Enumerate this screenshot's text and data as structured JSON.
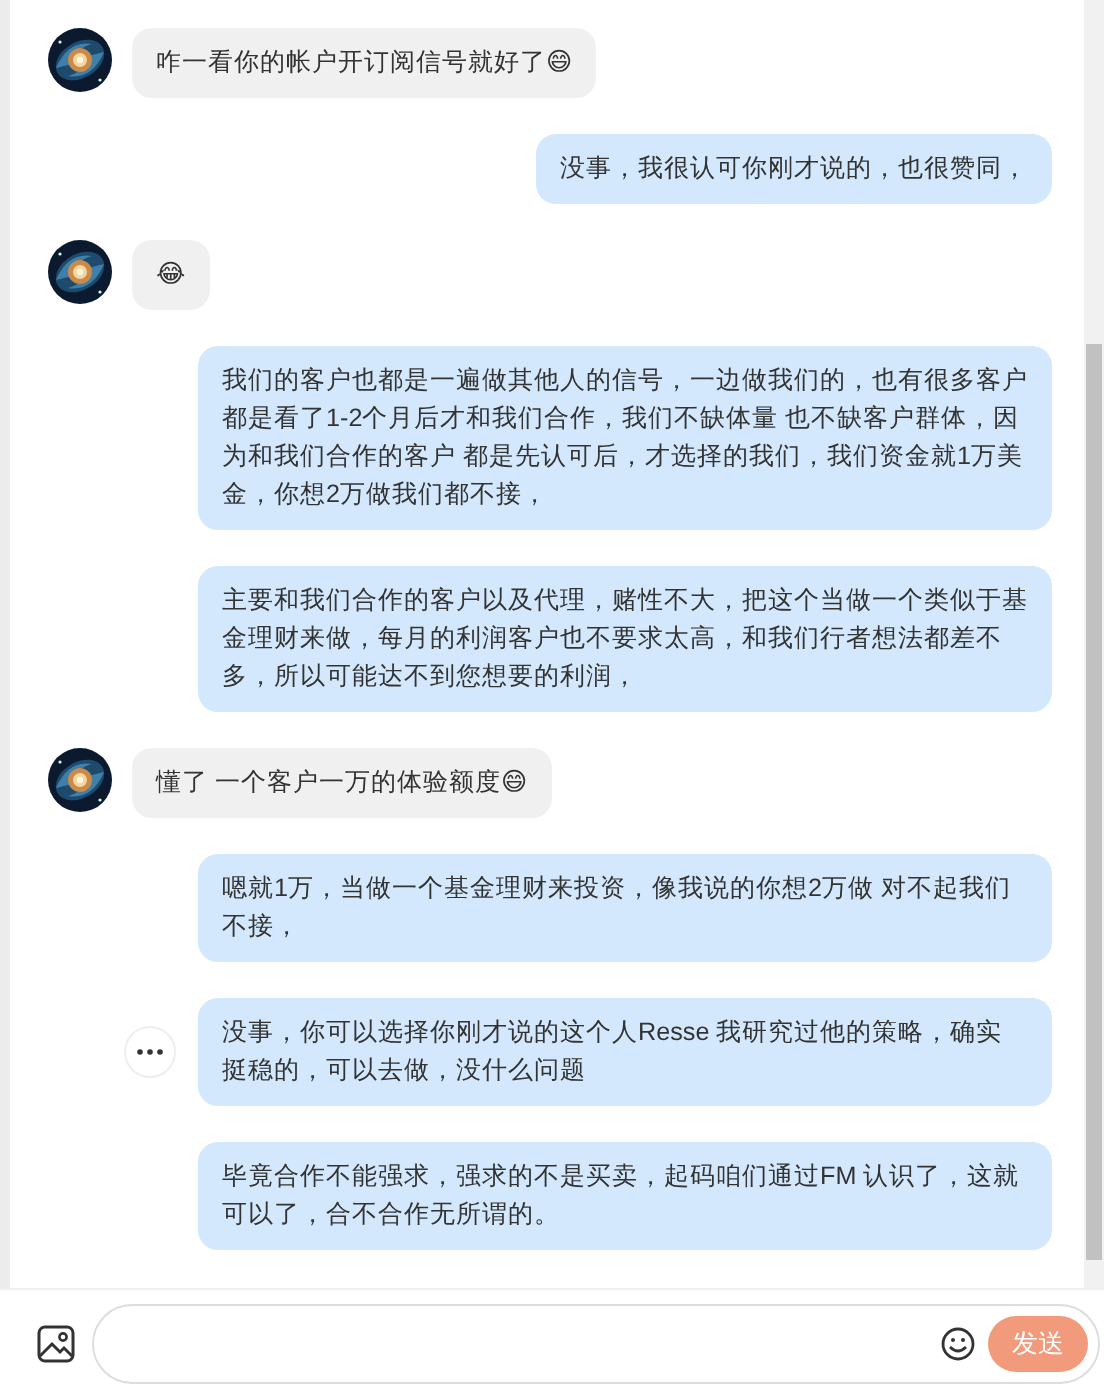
{
  "messages": [
    {
      "kind": "incoming",
      "text": "咋一看你的帐户开订阅信号就好了😄",
      "more_menu": false
    },
    {
      "kind": "outgoing",
      "text": "没事，我很认可你刚才说的，也很赞同，",
      "more_menu": false
    },
    {
      "kind": "incoming",
      "text": "😂",
      "more_menu": false
    },
    {
      "kind": "outgoing",
      "text": "我们的客户也都是一遍做其他人的信号，一边做我们的，也有很多客户都是看了1-2个月后才和我们合作，我们不缺体量 也不缺客户群体，因为和我们合作的客户 都是先认可后，才选择的我们，我们资金就1万美金，你想2万做我们都不接，",
      "more_menu": false
    },
    {
      "kind": "outgoing",
      "text": "主要和我们合作的客户以及代理，赌性不大，把这个当做一个类似于基金理财来做，每月的利润客户也不要求太高，和我们行者想法都差不多，所以可能达不到您想要的利润，",
      "more_menu": false
    },
    {
      "kind": "incoming",
      "text": "懂了 一个客户一万的体验额度😄",
      "more_menu": false
    },
    {
      "kind": "outgoing",
      "text": "嗯就1万，当做一个基金理财来投资，像我说的你想2万做 对不起我们不接，",
      "more_menu": false
    },
    {
      "kind": "outgoing",
      "text": "没事，你可以选择你刚才说的这个人Resse 我研究过他的策略，确实挺稳的，可以去做，没什么问题",
      "more_menu": true
    },
    {
      "kind": "outgoing",
      "text": "毕竟合作不能强求，强求的不是买卖，起码咱们通过FM 认识了，这就可以了，合不合作无所谓的。",
      "more_menu": false
    }
  ],
  "composer": {
    "send_button": {
      "label": "发送",
      "disabled": true
    }
  }
}
